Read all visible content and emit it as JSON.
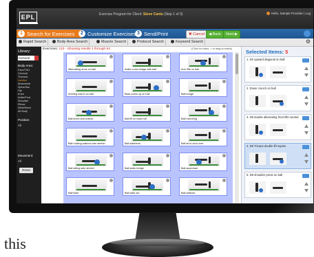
{
  "window": {
    "logo_text": "EPL",
    "program_title_prefix": "Exercise Program for Client:",
    "client_name": "Steve Canta",
    "step_info": "(Step 1 of 3)",
    "user_text": "Hello, Sample Provider | Log"
  },
  "steps": [
    {
      "num": "1",
      "label": "Search for Exercises"
    },
    {
      "num": "2",
      "label": "Customize Exercises"
    },
    {
      "num": "3",
      "label": "Send/Print"
    }
  ],
  "step_buttons": {
    "cancel": "✖ Cancel",
    "back": "◀ Back",
    "next": "Next ▶"
  },
  "search_tabs": [
    {
      "label": "Rapid Search"
    },
    {
      "label": "Body Area Search"
    },
    {
      "label": "Muscle Search"
    },
    {
      "label": "Protocol Search"
    },
    {
      "label": "Keyword Search"
    }
  ],
  "sidebar": {
    "library_label": "Library:",
    "library_value": "General",
    "body_area_label": "Body Area:",
    "body_areas": [
      "Face/TMJ",
      "Cervical",
      "Thoracic",
      "Lumbar",
      "Abdominal",
      "Spine/Sac",
      "Hip",
      "Knee",
      "Ankle/Foot",
      "Shoulder",
      "Elbow",
      "Wrist/Hand",
      "All Body"
    ],
    "highlighted_area": "Lumbar",
    "position_label": "Position:",
    "position_value": "All",
    "movement_label": "Movement:",
    "movement_value": "All",
    "reset_label": "Reset"
  },
  "exercises": {
    "heading_prefix": "Exercises:",
    "heading_count": "123 - Showing results 1 through 84",
    "hint": "(Click for video, + or drag to select)",
    "items": [
      "Alternating arms on ball",
      "Ankle cross bridge with ball",
      "Arm lifts on ball",
      "Arm/leg march on ball",
      "Back press up on ball",
      "Ball bridge",
      "Ball kneel and extend",
      "Ball lift on foam roll",
      "Ball marching",
      "Ball rocking walkout arm stretch",
      "Ball sidebend",
      "Ball sit to arch over",
      "Ball sitting side stretch",
      "Ball static bridge",
      "Ball superman",
      "Ball twist",
      "Ball walk out",
      "Ball walkout"
    ]
  },
  "selected": {
    "title": "Selected Items:",
    "count": "5",
    "items": [
      "1. D2 upward diagonal on ball",
      "2. Down crunch on ball",
      "3. D8 double alternating front lifts neutral",
      "4. D8 Triceps double lift supine",
      "5. D8 shoulder press on ball"
    ]
  },
  "caption": "this",
  "colors": {
    "active_step": "#e97b1b",
    "step_bar": "#1f5590",
    "tile_border": "#7e8df0",
    "selected_title": "#1d6bbd",
    "count_red": "#e33333"
  }
}
